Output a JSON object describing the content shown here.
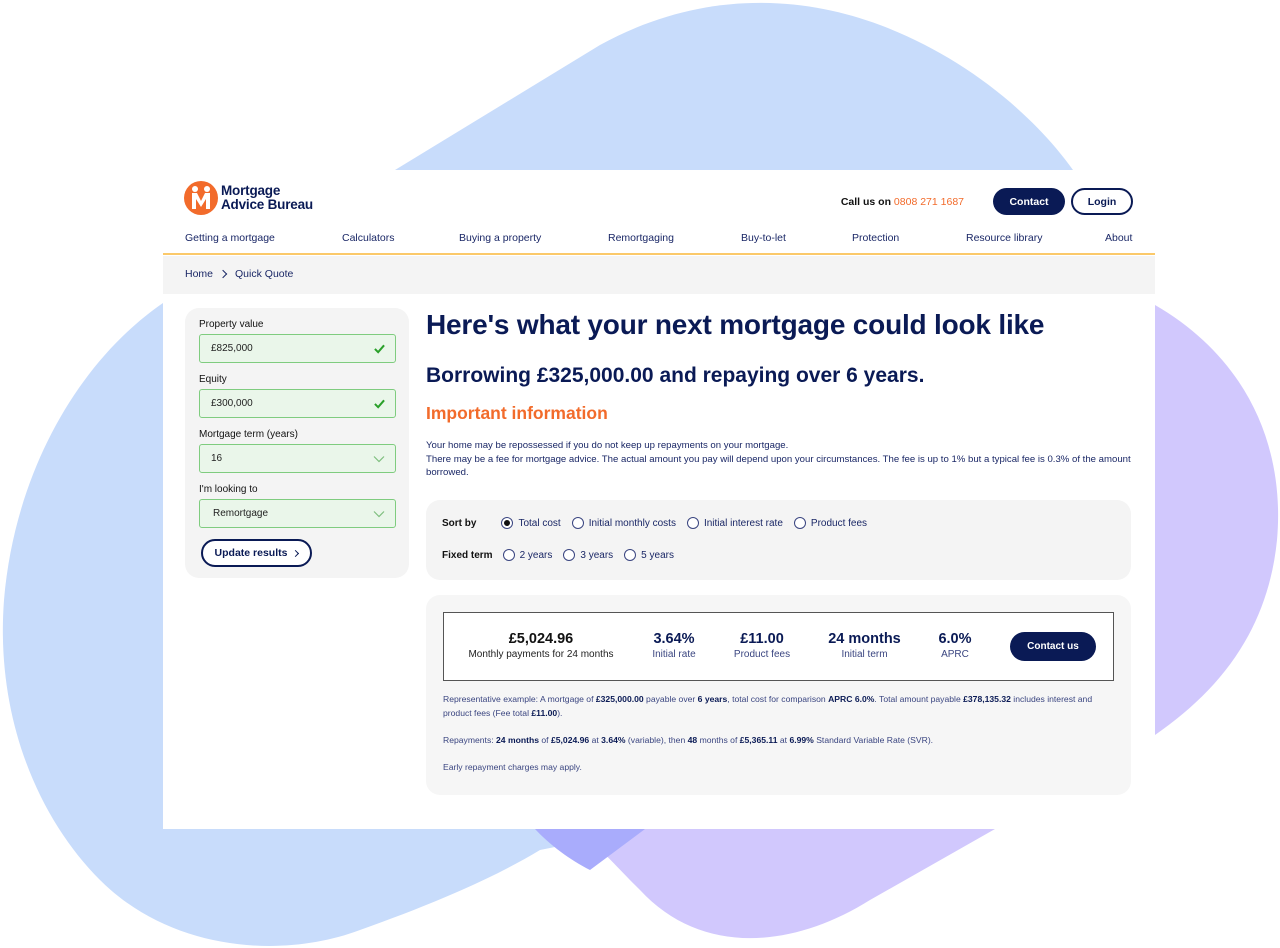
{
  "colors": {
    "brand_navy": "#0a1a55",
    "brand_orange": "#f26b2b",
    "nav_underline": "#fbc96a",
    "valid_border": "#7fcc7f",
    "valid_bg": "#eaf6ea",
    "valid_check": "#2aa02a",
    "panel_bg": "#f4f4f4",
    "blob_blue": "#c8dcfb",
    "blob_purple": "#d1c8fd",
    "blob_overlap": "#a9acfc"
  },
  "header": {
    "logo": {
      "icon": "mab-handshake-logo-icon",
      "line1": "Mortgage",
      "line2": "Advice Bureau"
    },
    "call_prefix": "Call us on",
    "phone": "0808 271 1687",
    "contact_label": "Contact",
    "login_label": "Login"
  },
  "nav": {
    "items": [
      "Getting a mortgage",
      "Calculators",
      "Buying a property",
      "Remortgaging",
      "Buy-to-let",
      "Protection",
      "Resource library",
      "About"
    ]
  },
  "breadcrumb": {
    "home": "Home",
    "separator_icon": "chevron-right-icon",
    "current": "Quick Quote"
  },
  "form": {
    "property_value": {
      "label": "Property value",
      "value": "£825,000",
      "status_icon": "check-icon"
    },
    "equity": {
      "label": "Equity",
      "value": "£300,000",
      "status_icon": "check-icon"
    },
    "term": {
      "label": "Mortgage term (years)",
      "value": "16",
      "icon": "chevron-down-icon"
    },
    "looking_to": {
      "label": "I'm looking to",
      "value": "Remortgage",
      "icon": "chevron-down-icon"
    },
    "update_label": "Update results"
  },
  "main": {
    "title": "Here's what your next mortgage could look like",
    "subtitle": "Borrowing £325,000.00 and repaying over 6 years.",
    "important_heading": "Important information",
    "info_line1": "Your home may be repossessed if you do not keep up repayments on your mortgage.",
    "info_line2": "There may be a fee for mortgage advice. The actual amount you pay will depend upon your circumstances. The fee is up to 1% but a typical fee is 0.3% of the amount borrowed."
  },
  "sort": {
    "label": "Sort by",
    "options": [
      {
        "label": "Total cost",
        "selected": true
      },
      {
        "label": "Initial monthly costs",
        "selected": false
      },
      {
        "label": "Initial interest rate",
        "selected": false
      },
      {
        "label": "Product fees",
        "selected": false
      }
    ]
  },
  "fixed_term": {
    "label": "Fixed term",
    "options": [
      {
        "label": "2 years",
        "selected": false
      },
      {
        "label": "3 years",
        "selected": false
      },
      {
        "label": "5 years",
        "selected": false
      }
    ]
  },
  "result": {
    "monthly": {
      "value": "£5,024.96",
      "label": "Monthly payments for 24 months"
    },
    "rate": {
      "value": "3.64%",
      "label": "Initial rate"
    },
    "fees": {
      "value": "£11.00",
      "label": "Product fees"
    },
    "term": {
      "value": "24 months",
      "label": "Initial term"
    },
    "aprc": {
      "value": "6.0%",
      "label": "APRC"
    },
    "contact_label": "Contact us",
    "rep_example": {
      "t1": "Representative example: A mortgage of ",
      "amount": "£325,000.00",
      "t2": " payable over ",
      "years": "6 years",
      "t3": ", total cost for comparison ",
      "aprc": "APRC 6.0%",
      "t4": ". Total amount payable ",
      "total": "£378,135.32",
      "t5": " includes interest and product fees (Fee total ",
      "fee_total": "£11.00",
      "t6": ")."
    },
    "repayments": {
      "t1": "Repayments: ",
      "initial_months": "24 months",
      "t2": " of ",
      "initial_payment": "£5,024.96",
      "t3": " at ",
      "initial_rate": "3.64%",
      "t4": " (variable), then ",
      "later_months": "48",
      "t5": " months of ",
      "later_payment": "£5,365.11",
      "t6": " at ",
      "svr_rate": "6.99%",
      "t7": " Standard Variable Rate (SVR)."
    },
    "early_repayment": "Early repayment charges may apply."
  }
}
